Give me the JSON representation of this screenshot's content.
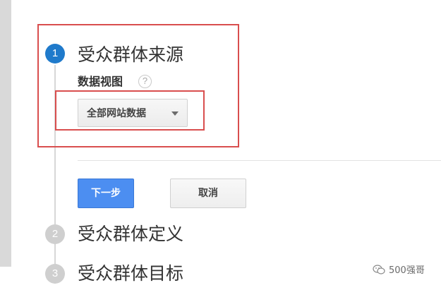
{
  "steps": [
    {
      "number": "1",
      "title": "受众群体来源",
      "state": "active"
    },
    {
      "number": "2",
      "title": "受众群体定义",
      "state": "inactive"
    },
    {
      "number": "3",
      "title": "受众群体目标",
      "state": "inactive"
    }
  ],
  "source_step": {
    "view_label": "数据视图",
    "help_glyph": "?",
    "view_select": {
      "value": "全部网站数据"
    }
  },
  "actions": {
    "next_label": "下一步",
    "cancel_label": "取消"
  },
  "watermark": {
    "text": "500强哥"
  },
  "colors": {
    "active_step": "#1f7acb",
    "inactive_step": "#cfcfcf",
    "primary_button": "#4c8ef1",
    "highlight_outline": "#d94e4e"
  },
  "icons": {
    "help": "question-circle-icon",
    "dropdown": "caret-down-icon",
    "watermark": "wechat-icon"
  }
}
